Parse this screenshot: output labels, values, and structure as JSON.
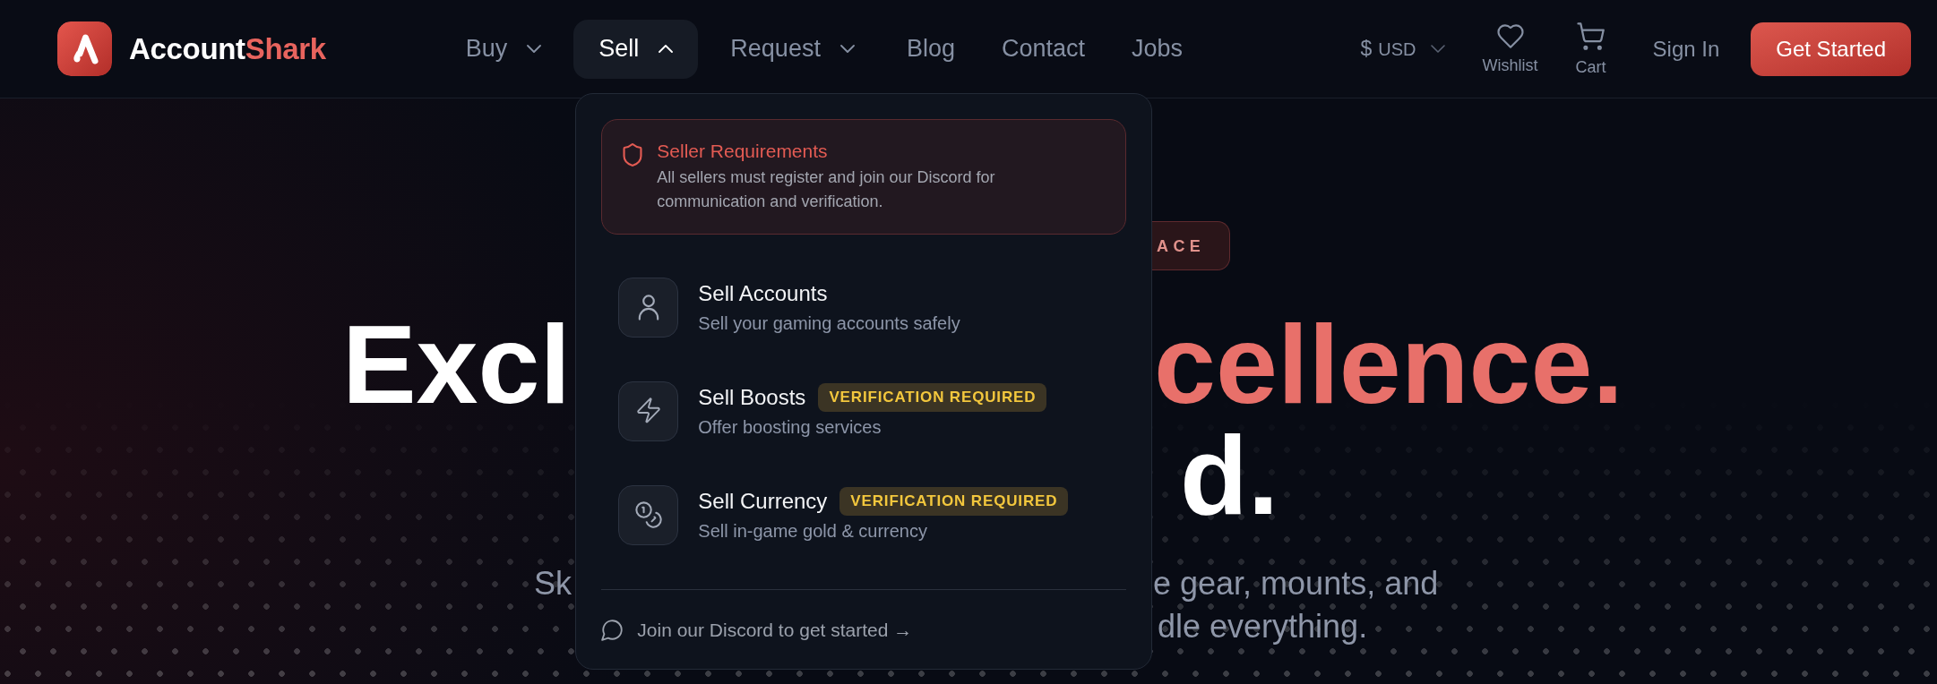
{
  "brand": {
    "name": "Account",
    "accent": "Shark"
  },
  "nav": {
    "items": [
      {
        "label": "Buy",
        "kind": "menu",
        "expanded": false,
        "selected": false
      },
      {
        "label": "Sell",
        "kind": "menu",
        "expanded": true,
        "selected": true,
        "menu": {
          "notice": {
            "title": "Seller Requirements",
            "text": "All sellers must register and join our Discord for communication and verification."
          },
          "items": [
            {
              "kind": "accounts",
              "title": "Sell Accounts",
              "description": "Sell your gaming accounts safely"
            },
            {
              "kind": "boosts",
              "title": "Sell Boosts",
              "badge": "VERIFICATION REQUIRED",
              "description": "Offer boosting services"
            },
            {
              "kind": "currency",
              "title": "Sell Currency",
              "badge": "VERIFICATION REQUIRED",
              "description": "Sell in-game gold & currency"
            }
          ],
          "footer_link": "Join our Discord to get started →"
        }
      },
      {
        "label": "Request",
        "kind": "menu",
        "expanded": false,
        "selected": false
      },
      {
        "label": "Blog",
        "kind": "link",
        "selected": false
      },
      {
        "label": "Contact",
        "kind": "link",
        "selected": false
      },
      {
        "label": "Jobs",
        "kind": "link",
        "selected": false
      }
    ]
  },
  "currency": {
    "symbol": "$",
    "code": "USD"
  },
  "actions": [
    {
      "kind": "wishlist",
      "label": "Wishlist"
    },
    {
      "kind": "cart",
      "label": "Cart"
    }
  ],
  "sign_in": "Sign In",
  "cta": "Get Started",
  "hero": {
    "badge": "ACE",
    "headline_lines": [
      {
        "left": {
          "text": "Excl",
          "accent": false
        },
        "right": {
          "text": "cellence.",
          "accent": true
        }
      },
      {
        "right": {
          "text": "d.",
          "accent": false
        }
      }
    ],
    "subtitle_lines": [
      {
        "left": "Sk",
        "right": "e gear, mounts, and"
      },
      {
        "right": "dle everything."
      }
    ]
  }
}
